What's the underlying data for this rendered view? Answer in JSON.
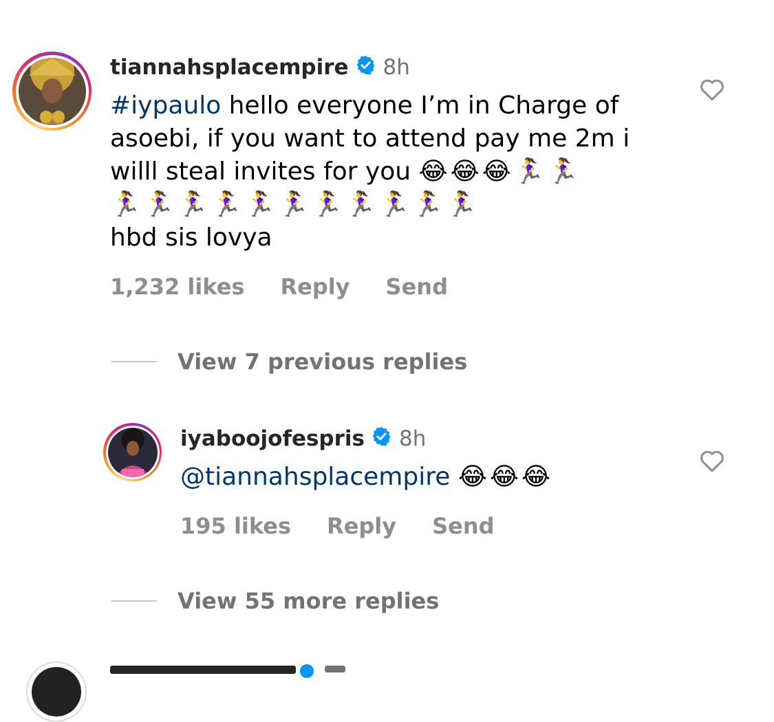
{
  "comments": [
    {
      "username": "tiannahsplacempire",
      "time": "8h",
      "hashtag": "#iypaulo",
      "line1_rest": " hello everyone I’m in Charge of",
      "line2": "asoebi, if you want to attend pay me 2m i",
      "line3": "willl steal invites for you",
      "line3_emojis": "😂😂😂🏃‍♀️🏃‍♀️",
      "line4_emojis": "🏃‍♀️🏃‍♀️🏃‍♀️🏃‍♀️🏃‍♀️🏃‍♀️🏃‍♀️🏃‍♀️🏃‍♀️🏃‍♀️🏃‍♀️",
      "line5": "hbd sis lovya",
      "likes": "1,232 likes",
      "reply_label": "Reply",
      "send_label": "Send",
      "view_replies": "View 7 previous replies"
    },
    {
      "username": "iyaboojofespris",
      "time": "8h",
      "mention": "@tiannahsplacempire",
      "emojis": "😂😂😂",
      "likes": "195 likes",
      "reply_label": "Reply",
      "send_label": "Send",
      "view_replies": "View 55 more replies"
    }
  ],
  "icons": {
    "heart": "heart-outline-icon",
    "verified": "verified-badge-icon"
  },
  "colors": {
    "mention": "#00376b",
    "verified": "#0095f6",
    "secondary_text": "#737373",
    "action_text": "#8e8e8e"
  }
}
